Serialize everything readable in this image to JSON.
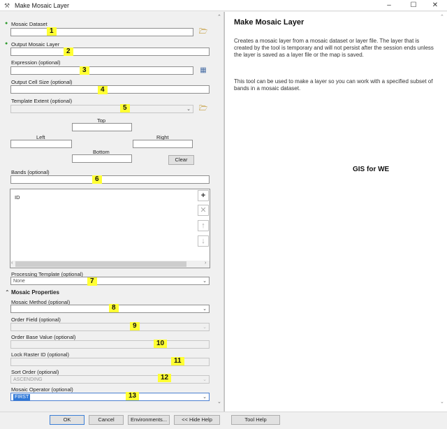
{
  "window": {
    "title": "Make Mosaic Layer",
    "minimize": "–",
    "maximize": "☐",
    "close": "✕"
  },
  "form": {
    "mosaic_dataset_label": "Mosaic Dataset",
    "output_layer_label": "Output Mosaic Layer",
    "expression_label": "Expression (optional)",
    "cell_size_label": "Output Cell Size (optional)",
    "template_extent_label": "Template Extent (optional)",
    "top_label": "Top",
    "left_label": "Left",
    "right_label": "Right",
    "bottom_label": "Bottom",
    "clear_label": "Clear",
    "bands_label": "Bands (optional)",
    "bands_list": [
      "ID"
    ],
    "processing_template_label": "Processing Template (optional)",
    "processing_template_value": "None",
    "mosaic_properties_label": "Mosaic Properties",
    "mosaic_method_label": "Mosaic Method (optional)",
    "order_field_label": "Order Field (optional)",
    "order_base_label": "Order Base Value (optional)",
    "lock_raster_label": "Lock Raster ID (optional)",
    "sort_order_label": "Sort Order (optional)",
    "sort_order_value": "ASCENDING",
    "mosaic_operator_label": "Mosaic Operator (optional)",
    "mosaic_operator_value": "FIRST"
  },
  "markers": [
    "1",
    "2",
    "3",
    "4",
    "5",
    "6",
    "7",
    "8",
    "9",
    "10",
    "11",
    "12",
    "13"
  ],
  "help": {
    "title": "Make Mosaic Layer",
    "para1": "Creates a mosaic layer from a mosaic dataset or layer file. The layer that is created by the tool is temporary and will not persist after the session ends unless the layer is saved as a layer file or the map is saved.",
    "para2": "This tool can be used to make a layer so you can work with a specified subset of bands in a mosaic dataset.",
    "watermark": "GIS for WE"
  },
  "buttons": {
    "ok": "OK",
    "cancel": "Cancel",
    "environments": "Environments...",
    "hide_help": "<< Hide Help",
    "tool_help": "Tool Help"
  },
  "icons": {
    "add": "+",
    "remove": "✕",
    "up": "↑",
    "down": "↓",
    "folder": "🗁",
    "calc": "▦",
    "chevron": "⌄",
    "collapse": "⌃"
  }
}
